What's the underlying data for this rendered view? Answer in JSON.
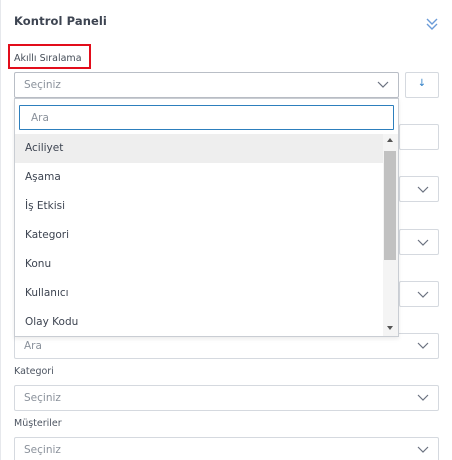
{
  "panel": {
    "title": "Kontrol Paneli",
    "collapse_icon": "double-chevron-down-icon"
  },
  "smart_sort": {
    "label": "Akıllı Sıralama",
    "select_value": "Seçiniz",
    "sort_button_icon": "arrow-down-icon",
    "sort_button_glyph": "↓"
  },
  "dropdown": {
    "search_placeholder": "Ara",
    "items": [
      "Aciliyet",
      "Aşama",
      "İş Etkisi",
      "Kategori",
      "Konu",
      "Kullanıcı",
      "Olay Kodu"
    ],
    "active_index": 0
  },
  "fields": {
    "ara_value": "Ara",
    "kategori_label": "Kategori",
    "kategori_value": "Seçiniz",
    "musteriler_label": "Müşteriler",
    "musteriler_value": "Seçiniz"
  },
  "colors": {
    "highlight": "#e20d1b",
    "accent": "#2d7fbd",
    "icon": "#6a9bd8"
  }
}
